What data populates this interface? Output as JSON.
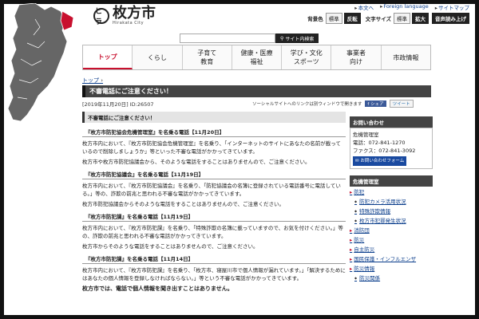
{
  "header": {
    "logo_mark": "ヒラ",
    "logo_title": "枚方市",
    "logo_subtitle": "Hirakata City",
    "top_links": [
      "本文へ",
      "Foreign language",
      "サイトマップ"
    ],
    "bg_color_label": "背景色",
    "bg_standard": "標準",
    "bg_invert": "反転",
    "font_size_label": "文字サイズ",
    "font_standard": "標準",
    "font_large": "拡大",
    "read_aloud": "音声読み上げ",
    "search_placeholder": "",
    "search_button": "サイト内検索"
  },
  "nav": {
    "items": [
      "トップ",
      "くらし",
      "子育て\n教育",
      "健康・医療\n福祉",
      "学び・文化\nスポーツ",
      "事業者\n向け",
      "市政情報"
    ]
  },
  "breadcrumb": "トップ",
  "page_title": "不審電話にご注意ください！",
  "meta": "[2019年11月20日]  ID:26507",
  "social": {
    "note": "ソーシャルサイトへのリンクは別ウィンドウで開きます",
    "share": "f シェア",
    "tweet": "ツイート"
  },
  "article": {
    "lead": "不審電話にご注意ください！",
    "sections": [
      {
        "title": "『枚方市防犯協会危機管理室』を名乗る電話【11月20日】",
        "paras": [
          "枚方市内において、『枚方市防犯協会危機管理室』を名乗り、「インターネットのサイトにあなたの名前が載っているので削除しましょうか」等といった不審な電話がかかってきています。",
          "枚方市や枚方市防犯協議会から、そのような電話をすることはありませんので、ご注意ください。"
        ]
      },
      {
        "title": "『枚方市防犯協議会』を名乗る電話【11月19日】",
        "paras": [
          "枚方市内において、『枚方市防犯協議会』を名乗り、「防犯協議会の名簿に登録されている電話番号に電話している。」等の、詐欺の前兆と思われる不審な電話がかかってきています。",
          "枚方市防犯協議会からそのような電話をすることはありませんので、ご注意ください。"
        ]
      },
      {
        "title": "『枚方市防犯課』を名乗る電話【11月19日】",
        "paras": [
          "枚方市内において、『枚方市防犯課』を名乗り、「特殊詐欺の名簿に載っていますので、お気を付けください。」等の、詐欺の前兆と思われる不審な電話がかかってきています。",
          "枚方市からそのような電話をすることはありませんので、ご注意ください。"
        ]
      },
      {
        "title": "『枚方市防犯課』を名乗る電話【11月14日】",
        "paras": [
          "枚方市内において、『枚方市防犯課』を名乗り、「枚方市、寝屋川市で個人情報が漏れています。」「解決するためにはあなたの個人情報を登録しなければならない。」等という不審な電話がかかってきています。"
        ]
      }
    ],
    "footer": "枚方市では、電話で個人情報を聞き出すことはありません。"
  },
  "sidebar": {
    "contact_title": "お問い合わせ",
    "dept": "危機管理室",
    "tel": "電話：072-841-1270",
    "fax": "ファクス：072-841-3092",
    "mail_button": "お問い合わせフォーム",
    "menu_title": "危機管理室",
    "menu": [
      {
        "label": "防犯",
        "type": "main"
      },
      {
        "label": "防犯カメラ活用状況",
        "type": "sub"
      },
      {
        "label": "特殊詐欺情報",
        "type": "sub"
      },
      {
        "label": "枚方市犯罪発生状況",
        "type": "sub"
      },
      {
        "label": "消防団",
        "type": "main"
      },
      {
        "label": "防災",
        "type": "main"
      },
      {
        "label": "自主防災",
        "type": "main"
      },
      {
        "label": "国民保護・インフルエンザ",
        "type": "main"
      },
      {
        "label": "防災情報",
        "type": "main"
      },
      {
        "label": "防災関係",
        "type": "sub"
      }
    ]
  }
}
